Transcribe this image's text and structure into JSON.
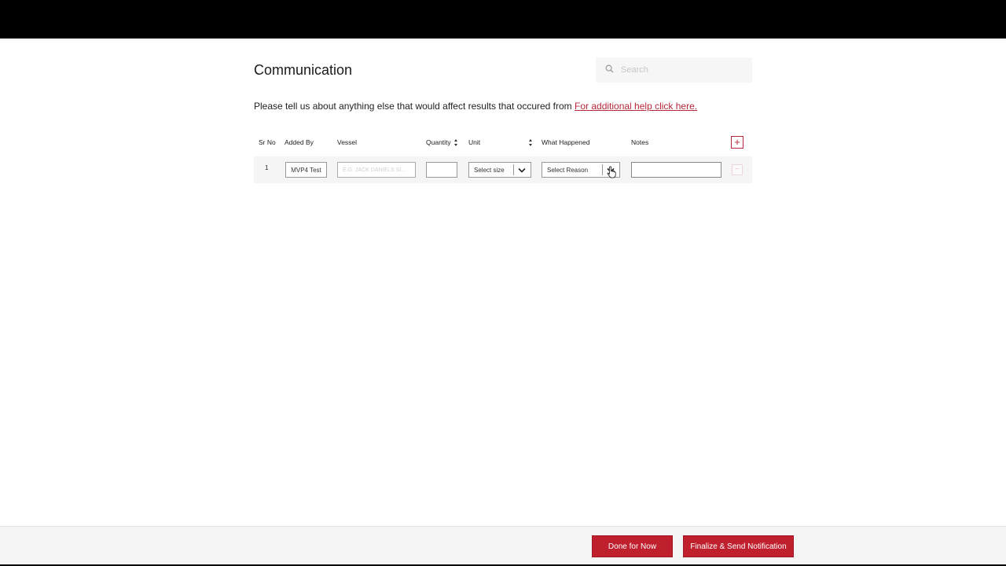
{
  "page": {
    "title": "Communication",
    "intro_text": "Please tell us about anything else that would affect results that occured from ",
    "help_link": "For additional help click here."
  },
  "search": {
    "placeholder": "Search"
  },
  "table": {
    "headers": {
      "sr_no": "Sr No",
      "added_by": "Added By",
      "vessel": "Vessel",
      "quantity": "Quantity",
      "unit": "Unit",
      "what_happened": "What Happened",
      "notes": "Notes"
    },
    "add_button": "+",
    "remove_button": "−",
    "rows": [
      {
        "sr_no": "1",
        "added_by": "MVP4 Test",
        "vessel_placeholder": "E.G. JACK DANIELS SI...",
        "quantity": "",
        "unit": "Select size",
        "what_happened": "Select Reason",
        "notes": ""
      }
    ]
  },
  "footer": {
    "done_label": "Done for Now",
    "finalize_label": "Finalize & Send Notification"
  },
  "colors": {
    "accent": "#c0202e",
    "link": "#b8283a"
  }
}
